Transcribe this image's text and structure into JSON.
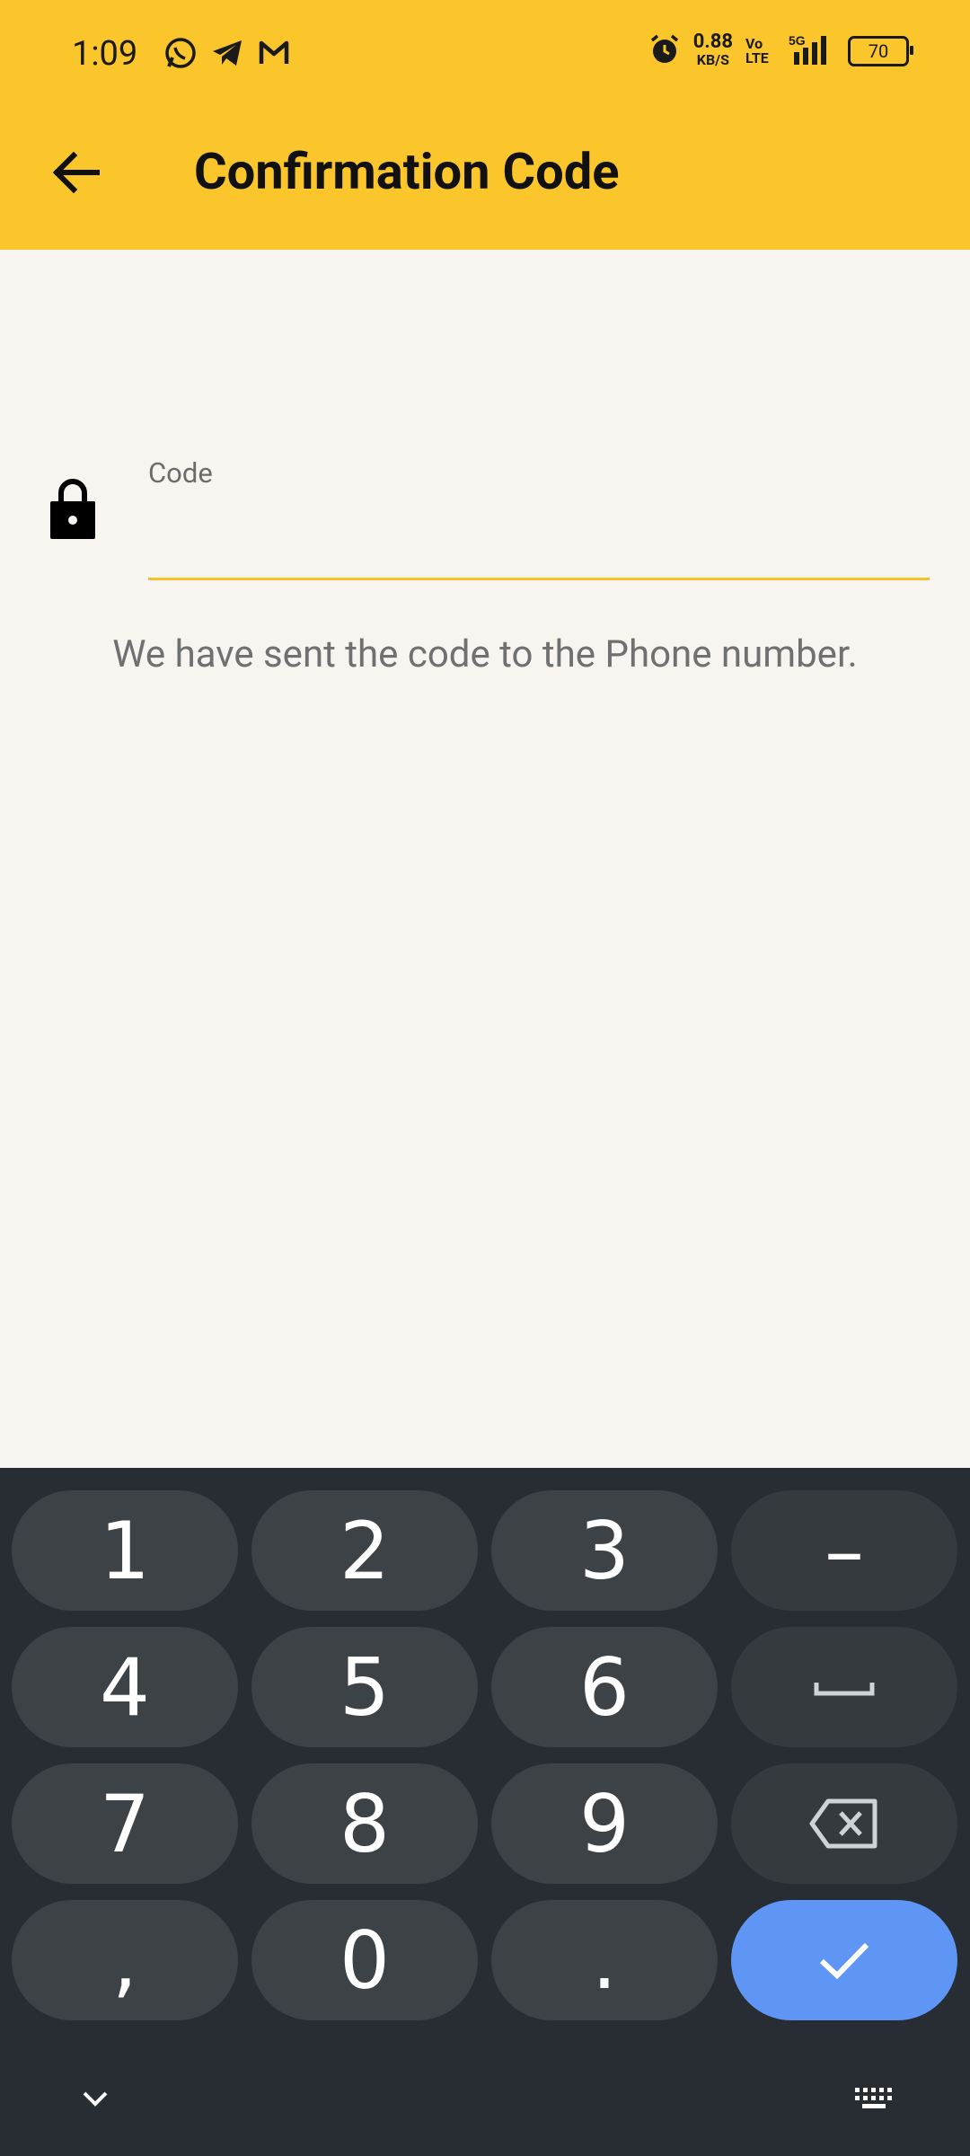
{
  "status_bar": {
    "time": "1:09",
    "net_speed": "0.88",
    "net_speed_unit": "KB/S",
    "volte": "Vo LTE",
    "network": "5G",
    "battery": "70"
  },
  "app_bar": {
    "title": "Confirmation Code"
  },
  "form": {
    "code_label": "Code",
    "code_value": "",
    "hint": "We have sent the code to the Phone number."
  },
  "keyboard": {
    "keys": {
      "k1": "1",
      "k2": "2",
      "k3": "3",
      "dash": "–",
      "k4": "4",
      "k5": "5",
      "k6": "6",
      "k7": "7",
      "k8": "8",
      "k9": "9",
      "comma": ",",
      "k0": "0",
      "period": "."
    }
  },
  "colors": {
    "app_bar": "#fac62c",
    "background": "#f8f5f0",
    "input_underline": "#f2c12c",
    "keyboard_bg": "#282d33",
    "key_bg": "#3d4247",
    "enter_key": "#5f96f5"
  }
}
